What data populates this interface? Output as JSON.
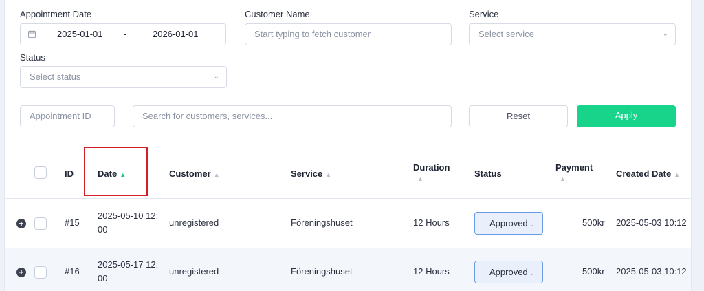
{
  "filters": {
    "appointment_date_label": "Appointment Date",
    "date_from": "2025-01-01",
    "date_sep": "-",
    "date_to": "2026-01-01",
    "customer_name_label": "Customer Name",
    "customer_placeholder": "Start typing to fetch customer",
    "service_label": "Service",
    "service_placeholder": "Select service",
    "status_label": "Status",
    "status_placeholder": "Select status",
    "appointment_id_placeholder": "Appointment ID",
    "search_placeholder": "Search for customers, services...",
    "reset_label": "Reset",
    "apply_label": "Apply"
  },
  "table": {
    "headers": {
      "id": "ID",
      "date": "Date",
      "customer": "Customer",
      "service": "Service",
      "duration_1": "Duration",
      "status": "Status",
      "payment": "Payment",
      "created": "Created Date"
    },
    "rows": [
      {
        "id": "#15",
        "date_line1": "2025-05-10 12:",
        "date_line2": "00",
        "customer": "unregistered",
        "service": "Föreningshuset",
        "duration": "12 Hours",
        "status": "Approved",
        "payment": "500kr",
        "created": "2025-05-03 10:12"
      },
      {
        "id": "#16",
        "date_line1": "2025-05-17 12:",
        "date_line2": "00",
        "customer": "unregistered",
        "service": "Föreningshuset",
        "duration": "12 Hours",
        "status": "Approved",
        "payment": "500kr",
        "created": "2025-05-03 10:12"
      }
    ]
  },
  "colors": {
    "apply": "#17d48a",
    "highlight_box": "#d01f26",
    "badge_border": "#6a9be6",
    "row_alt": "#f3f6fb"
  },
  "icons": {
    "calendar": "calendar-icon",
    "chevron": "chevron-down-icon",
    "sort": "sort-icon",
    "expand": "plus-circle-icon"
  }
}
